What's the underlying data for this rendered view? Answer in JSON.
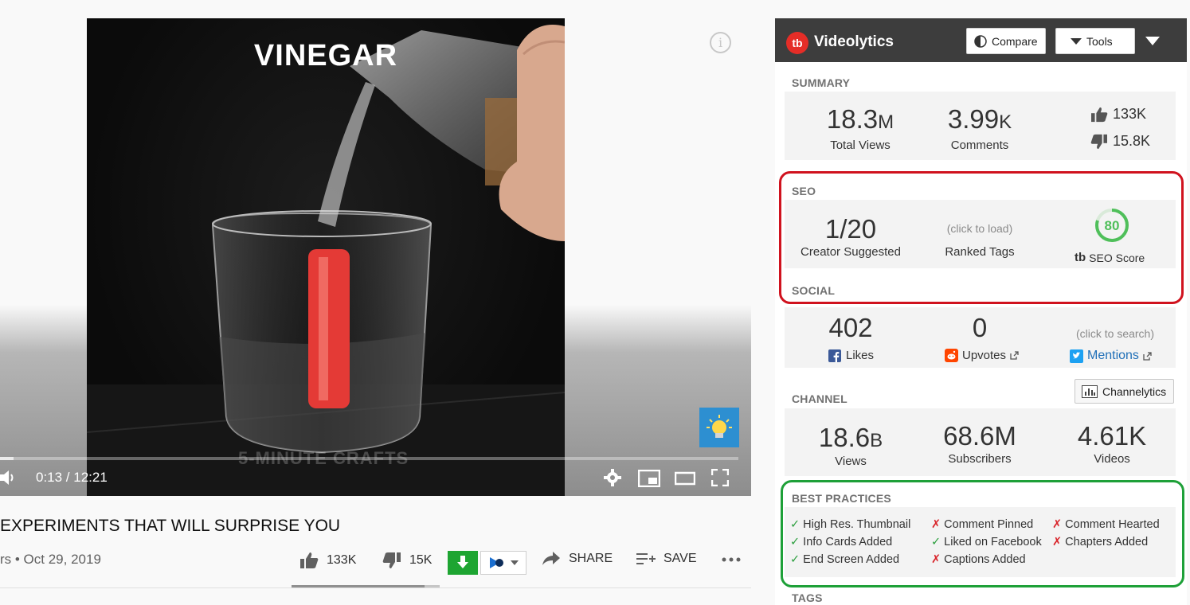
{
  "video": {
    "overlay_text": "VINEGAR",
    "watermark": "5-MINUTE CRAFTS",
    "time": "0:13 / 12:21",
    "progress": 0.018
  },
  "below": {
    "title": "EXPERIMENTS THAT WILL SURPRISE YOU",
    "meta": "rs • Oct 29, 2019",
    "likes": "133K",
    "dislikes": "15K",
    "share": "SHARE",
    "save": "SAVE",
    "like_ratio": 0.9
  },
  "panel": {
    "brand": "Videolytics",
    "compare": "Compare",
    "tools": "Tools",
    "summary": {
      "label": "SUMMARY",
      "views_num": "18.3",
      "views_unit": "M",
      "views_label": "Total Views",
      "comments_num": "3.99",
      "comments_unit": "K",
      "comments_label": "Comments",
      "likes": "133K",
      "dislikes": "15.8K"
    },
    "seo": {
      "label": "SEO",
      "suggested": "1/20",
      "suggested_label": "Creator Suggested",
      "ranked_hint": "(click to load)",
      "ranked_label": "Ranked Tags",
      "score": "80",
      "score_value": 0.8,
      "score_label": "SEO Score",
      "score_logo": "tb"
    },
    "social": {
      "label": "SOCIAL",
      "fb_value": "402",
      "fb_label": "Likes",
      "reddit_value": "0",
      "reddit_label": "Upvotes",
      "twitter_hint": "(click to search)",
      "twitter_label": "Mentions"
    },
    "channel": {
      "label": "CHANNEL",
      "button": "Channelytics",
      "views_num": "18.6",
      "views_unit": "B",
      "views_label": "Views",
      "subs": "68.6M",
      "subs_label": "Subscribers",
      "videos": "4.61K",
      "videos_label": "Videos"
    },
    "best_practices": {
      "label": "BEST PRACTICES",
      "items": [
        {
          "mark": "✓",
          "text": "High Res. Thumbnail"
        },
        {
          "mark": "✗",
          "text": "Comment Pinned"
        },
        {
          "mark": "✗",
          "text": "Comment Hearted"
        },
        {
          "mark": "✓",
          "text": "Info Cards Added"
        },
        {
          "mark": "✓",
          "text": "Liked on Facebook"
        },
        {
          "mark": "✗",
          "text": "Chapters Added"
        },
        {
          "mark": "✓",
          "text": "End Screen Added"
        },
        {
          "mark": "✗",
          "text": "Captions Added"
        }
      ]
    },
    "tags": {
      "label": "TAGS"
    }
  },
  "colors": {
    "ok": "#2c9f3e",
    "fail": "#d9262c",
    "highlight_red": "#d0121e",
    "highlight_green": "#1ea038",
    "brand_red": "#e52d27"
  }
}
